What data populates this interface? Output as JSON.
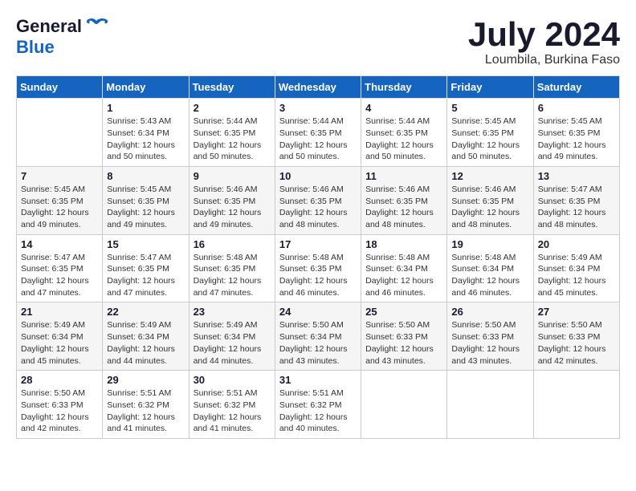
{
  "header": {
    "logo_general": "General",
    "logo_blue": "Blue",
    "main_title": "July 2024",
    "subtitle": "Loumbila, Burkina Faso"
  },
  "calendar": {
    "columns": [
      "Sunday",
      "Monday",
      "Tuesday",
      "Wednesday",
      "Thursday",
      "Friday",
      "Saturday"
    ],
    "weeks": [
      [
        {
          "day": "",
          "info": ""
        },
        {
          "day": "1",
          "info": "Sunrise: 5:43 AM\nSunset: 6:34 PM\nDaylight: 12 hours\nand 50 minutes."
        },
        {
          "day": "2",
          "info": "Sunrise: 5:44 AM\nSunset: 6:35 PM\nDaylight: 12 hours\nand 50 minutes."
        },
        {
          "day": "3",
          "info": "Sunrise: 5:44 AM\nSunset: 6:35 PM\nDaylight: 12 hours\nand 50 minutes."
        },
        {
          "day": "4",
          "info": "Sunrise: 5:44 AM\nSunset: 6:35 PM\nDaylight: 12 hours\nand 50 minutes."
        },
        {
          "day": "5",
          "info": "Sunrise: 5:45 AM\nSunset: 6:35 PM\nDaylight: 12 hours\nand 50 minutes."
        },
        {
          "day": "6",
          "info": "Sunrise: 5:45 AM\nSunset: 6:35 PM\nDaylight: 12 hours\nand 49 minutes."
        }
      ],
      [
        {
          "day": "7",
          "info": "Sunrise: 5:45 AM\nSunset: 6:35 PM\nDaylight: 12 hours\nand 49 minutes."
        },
        {
          "day": "8",
          "info": "Sunrise: 5:45 AM\nSunset: 6:35 PM\nDaylight: 12 hours\nand 49 minutes."
        },
        {
          "day": "9",
          "info": "Sunrise: 5:46 AM\nSunset: 6:35 PM\nDaylight: 12 hours\nand 49 minutes."
        },
        {
          "day": "10",
          "info": "Sunrise: 5:46 AM\nSunset: 6:35 PM\nDaylight: 12 hours\nand 48 minutes."
        },
        {
          "day": "11",
          "info": "Sunrise: 5:46 AM\nSunset: 6:35 PM\nDaylight: 12 hours\nand 48 minutes."
        },
        {
          "day": "12",
          "info": "Sunrise: 5:46 AM\nSunset: 6:35 PM\nDaylight: 12 hours\nand 48 minutes."
        },
        {
          "day": "13",
          "info": "Sunrise: 5:47 AM\nSunset: 6:35 PM\nDaylight: 12 hours\nand 48 minutes."
        }
      ],
      [
        {
          "day": "14",
          "info": "Sunrise: 5:47 AM\nSunset: 6:35 PM\nDaylight: 12 hours\nand 47 minutes."
        },
        {
          "day": "15",
          "info": "Sunrise: 5:47 AM\nSunset: 6:35 PM\nDaylight: 12 hours\nand 47 minutes."
        },
        {
          "day": "16",
          "info": "Sunrise: 5:48 AM\nSunset: 6:35 PM\nDaylight: 12 hours\nand 47 minutes."
        },
        {
          "day": "17",
          "info": "Sunrise: 5:48 AM\nSunset: 6:35 PM\nDaylight: 12 hours\nand 46 minutes."
        },
        {
          "day": "18",
          "info": "Sunrise: 5:48 AM\nSunset: 6:34 PM\nDaylight: 12 hours\nand 46 minutes."
        },
        {
          "day": "19",
          "info": "Sunrise: 5:48 AM\nSunset: 6:34 PM\nDaylight: 12 hours\nand 46 minutes."
        },
        {
          "day": "20",
          "info": "Sunrise: 5:49 AM\nSunset: 6:34 PM\nDaylight: 12 hours\nand 45 minutes."
        }
      ],
      [
        {
          "day": "21",
          "info": "Sunrise: 5:49 AM\nSunset: 6:34 PM\nDaylight: 12 hours\nand 45 minutes."
        },
        {
          "day": "22",
          "info": "Sunrise: 5:49 AM\nSunset: 6:34 PM\nDaylight: 12 hours\nand 44 minutes."
        },
        {
          "day": "23",
          "info": "Sunrise: 5:49 AM\nSunset: 6:34 PM\nDaylight: 12 hours\nand 44 minutes."
        },
        {
          "day": "24",
          "info": "Sunrise: 5:50 AM\nSunset: 6:34 PM\nDaylight: 12 hours\nand 43 minutes."
        },
        {
          "day": "25",
          "info": "Sunrise: 5:50 AM\nSunset: 6:33 PM\nDaylight: 12 hours\nand 43 minutes."
        },
        {
          "day": "26",
          "info": "Sunrise: 5:50 AM\nSunset: 6:33 PM\nDaylight: 12 hours\nand 43 minutes."
        },
        {
          "day": "27",
          "info": "Sunrise: 5:50 AM\nSunset: 6:33 PM\nDaylight: 12 hours\nand 42 minutes."
        }
      ],
      [
        {
          "day": "28",
          "info": "Sunrise: 5:50 AM\nSunset: 6:33 PM\nDaylight: 12 hours\nand 42 minutes."
        },
        {
          "day": "29",
          "info": "Sunrise: 5:51 AM\nSunset: 6:32 PM\nDaylight: 12 hours\nand 41 minutes."
        },
        {
          "day": "30",
          "info": "Sunrise: 5:51 AM\nSunset: 6:32 PM\nDaylight: 12 hours\nand 41 minutes."
        },
        {
          "day": "31",
          "info": "Sunrise: 5:51 AM\nSunset: 6:32 PM\nDaylight: 12 hours\nand 40 minutes."
        },
        {
          "day": "",
          "info": ""
        },
        {
          "day": "",
          "info": ""
        },
        {
          "day": "",
          "info": ""
        }
      ]
    ]
  }
}
